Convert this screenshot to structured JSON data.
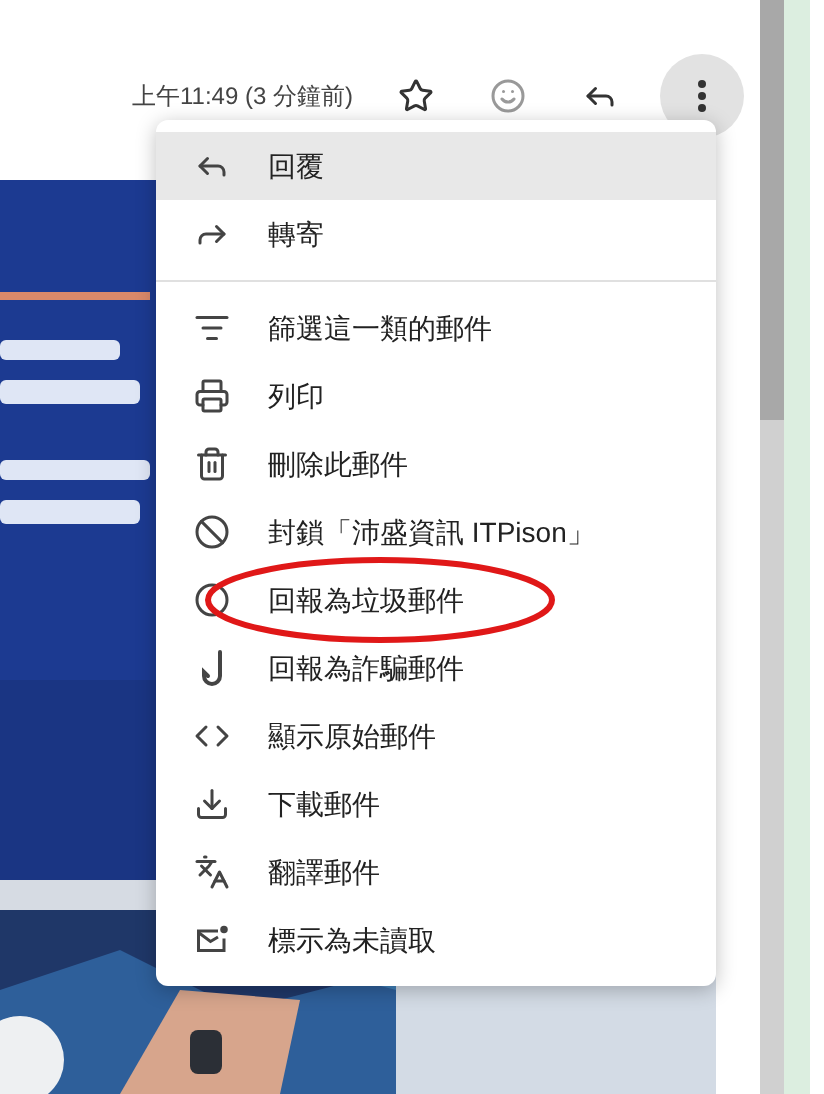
{
  "header": {
    "timestamp": "上午11:49 (3 分鐘前)",
    "more_button": {
      "active": true
    }
  },
  "menu": {
    "groups": [
      [
        {
          "label": "回覆",
          "hovered": true,
          "circled": false
        },
        {
          "label": "轉寄",
          "hovered": false,
          "circled": false
        }
      ],
      [
        {
          "label": "篩選這一類的郵件",
          "hovered": false,
          "circled": false
        },
        {
          "label": "列印",
          "hovered": false,
          "circled": false
        },
        {
          "label": "刪除此郵件",
          "hovered": false,
          "circled": false
        },
        {
          "label": "封鎖「沛盛資訊 ITPison」",
          "hovered": false,
          "circled": false
        },
        {
          "label": "回報為垃圾郵件",
          "hovered": false,
          "circled": true
        },
        {
          "label": "回報為詐騙郵件",
          "hovered": false,
          "circled": false
        },
        {
          "label": "顯示原始郵件",
          "hovered": false,
          "circled": false
        },
        {
          "label": "下載郵件",
          "hovered": false,
          "circled": false
        },
        {
          "label": "翻譯郵件",
          "hovered": false,
          "circled": false
        },
        {
          "label": "標示為未讀取",
          "hovered": false,
          "circled": false
        }
      ]
    ]
  }
}
